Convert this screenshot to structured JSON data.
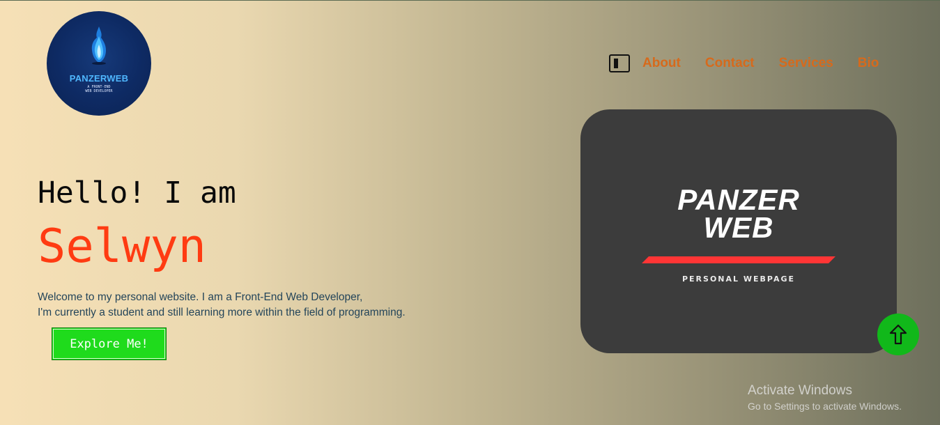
{
  "logo": {
    "title": "PANZERWEB",
    "subtitle": "A FRONT-END\nWEB DEVELOPER",
    "icon": "flame-icon"
  },
  "nav": {
    "theme_toggle_icon": "theme-toggle-icon",
    "items": [
      {
        "label": "About"
      },
      {
        "label": "Contact"
      },
      {
        "label": "Services"
      },
      {
        "label": "Bio"
      }
    ]
  },
  "hero": {
    "greeting": "Hello! I am",
    "name": "Selwyn",
    "intro_line1": "Welcome to my personal website. I am a Front-End Web Developer,",
    "intro_line2": "I'm currently a student and still learning more within the field of programming.",
    "cta_label": "Explore Me!"
  },
  "card": {
    "brand_line1": "PANZER",
    "brand_line2": "WEB",
    "tagline": "PERSONAL WEBPAGE"
  },
  "scroll_top": {
    "icon": "arrow-up-icon"
  },
  "watermark": {
    "title": "Activate Windows",
    "subtitle": "Go to Settings to activate Windows."
  },
  "colors": {
    "accent_orange": "#d66a1c",
    "name_red": "#ff3b12",
    "cta_green": "#1fdb1c",
    "scroll_green": "#11b81a",
    "card_bg": "#3c3c3c",
    "brand_bar_red": "#ff3535",
    "logo_blue": "#4fb7ff"
  }
}
